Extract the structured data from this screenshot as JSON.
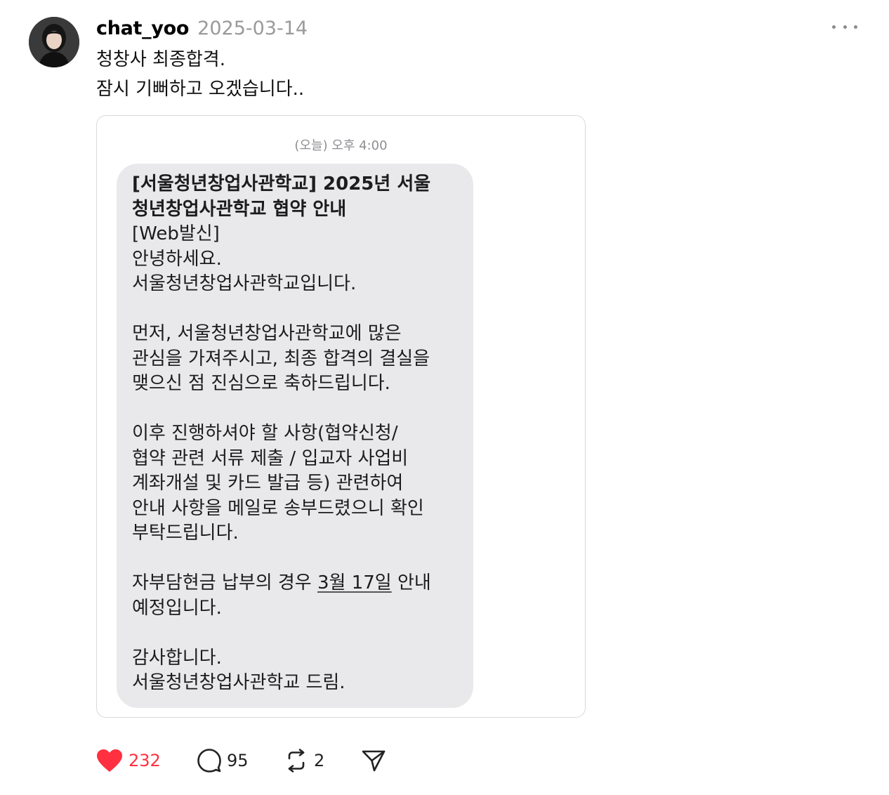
{
  "post": {
    "username": "chat_yoo",
    "date": "2025-03-14",
    "text_lines": [
      "청창사 최종합격.",
      "잠시 기뻐하고 오겠습니다.."
    ]
  },
  "message": {
    "time": "(오늘) 오후 4:00",
    "title_lines": [
      "[서울청년창업사관학교] 2025년 서울",
      "청년창업사관학교 협약 안내"
    ],
    "intro_lines": [
      "[Web발신]",
      "안녕하세요.",
      "서울청년창업사관학교입니다."
    ],
    "para1_lines": [
      "먼저, 서울청년창업사관학교에 많은",
      "관심을 가져주시고, 최종 합격의 결실을",
      "맺으신 점 진심으로 축하드립니다."
    ],
    "para2_lines": [
      "이후 진행하셔야 할 사항(협약신청/",
      "협약 관련 서류 제출 / 입교자 사업비",
      "계좌개설 및 카드 발급 등) 관련하여",
      "안내 사항을 메일로 송부드렸으니 확인",
      "부탁드립니다."
    ],
    "para3_prefix": "자부담현금 납부의 경우 ",
    "para3_date": "3월 17일",
    "para3_suffix": " 안내",
    "para3_line2": "예정입니다.",
    "closing_lines": [
      "감사합니다.",
      "서울청년창업사관학교 드림."
    ]
  },
  "actions": {
    "likes": "232",
    "replies": "95",
    "reposts": "2"
  },
  "colors": {
    "like": "#ff3040",
    "bubble": "#e9e9eb",
    "muted": "#9a9a9a"
  },
  "icons": [
    "heart-icon",
    "comment-icon",
    "repost-icon",
    "send-icon",
    "more-icon"
  ]
}
